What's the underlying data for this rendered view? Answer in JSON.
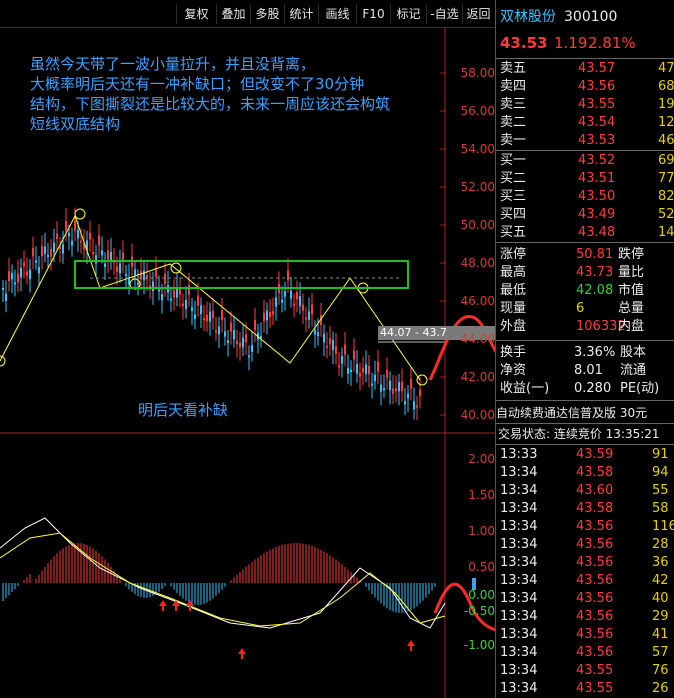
{
  "toolbar": {
    "buttons": [
      "复权",
      "叠加",
      "多股",
      "统计",
      "画线",
      "F10",
      "标记",
      "-自选",
      "返回"
    ]
  },
  "annotations": {
    "note_lines": [
      "虽然今天带了一波小量拉升，并且没背离，",
      "大概率明后天还有一冲补缺口；但改变不了30分钟",
      "结构，下图撕裂还是比较大的，未来一周应该还会构筑",
      "短线双底结构"
    ],
    "bottom_note": "明后天看补缺",
    "range_box": "44.07 - 43.7"
  },
  "price_axis": [
    "58.00",
    "56.00",
    "54.00",
    "52.00",
    "50.00",
    "48.00",
    "46.00",
    "44.00",
    "42.00",
    "40.00"
  ],
  "macd_axis": [
    "2.00",
    "1.50",
    "1.00",
    "0.50",
    "0.00",
    "-0.50",
    "-1.00"
  ],
  "stock": {
    "name": "双林股份",
    "code": "300100",
    "price": "43.53",
    "change": "1.19",
    "change_pct": "2.81%"
  },
  "order_book": {
    "asks": [
      {
        "label": "卖五",
        "price": "43.57",
        "vol": "47"
      },
      {
        "label": "卖四",
        "price": "43.56",
        "vol": "68"
      },
      {
        "label": "卖三",
        "price": "43.55",
        "vol": "190"
      },
      {
        "label": "卖二",
        "price": "43.54",
        "vol": "12"
      },
      {
        "label": "卖一",
        "price": "43.53",
        "vol": "46"
      }
    ],
    "bids": [
      {
        "label": "买一",
        "price": "43.52",
        "vol": "69"
      },
      {
        "label": "买二",
        "price": "43.51",
        "vol": "77"
      },
      {
        "label": "买三",
        "price": "43.50",
        "vol": "82"
      },
      {
        "label": "买四",
        "price": "43.49",
        "vol": "52"
      },
      {
        "label": "买五",
        "price": "43.48",
        "vol": "148"
      }
    ]
  },
  "stats": {
    "rows": [
      {
        "l1": "涨停",
        "v1": "50.81",
        "l2": "跌停"
      },
      {
        "l1": "最高",
        "v1": "43.73",
        "l2": "量比"
      },
      {
        "l1": "最低",
        "v1": "42.08",
        "l2": "市值"
      },
      {
        "l1": "现量",
        "v1": "6",
        "l2": "总量"
      },
      {
        "l1": "外盘",
        "v1": "106332",
        "l2": "内盘"
      }
    ]
  },
  "stats2": {
    "rows": [
      {
        "l1": "换手",
        "v1": "3.36%",
        "l2": "股本"
      },
      {
        "l1": "净资",
        "v1": "8.01",
        "l2": "流通"
      },
      {
        "l1": "收益(一)",
        "v1": "0.280",
        "l2": "PE(动)"
      }
    ]
  },
  "ad_text": "自动续费通达信普及版  30元",
  "trade_state": "交易状态: 连续竞价 13:35:21",
  "ticks": [
    {
      "t": "13:33",
      "p": "43.59",
      "v": "91"
    },
    {
      "t": "13:34",
      "p": "43.58",
      "v": "94"
    },
    {
      "t": "13:34",
      "p": "43.60",
      "v": "55"
    },
    {
      "t": "13:34",
      "p": "43.58",
      "v": "58"
    },
    {
      "t": "13:34",
      "p": "43.56",
      "v": "116"
    },
    {
      "t": "13:34",
      "p": "43.56",
      "v": "28"
    },
    {
      "t": "13:34",
      "p": "43.56",
      "v": "36"
    },
    {
      "t": "13:34",
      "p": "43.56",
      "v": "42"
    },
    {
      "t": "13:34",
      "p": "43.56",
      "v": "40"
    },
    {
      "t": "13:34",
      "p": "43.56",
      "v": "29"
    },
    {
      "t": "13:34",
      "p": "43.56",
      "v": "41"
    },
    {
      "t": "13:34",
      "p": "43.56",
      "v": "57"
    },
    {
      "t": "13:34",
      "p": "43.55",
      "v": "76"
    },
    {
      "t": "13:34",
      "p": "43.55",
      "v": "26"
    }
  ],
  "colors": {
    "up": "#ff3b3b",
    "down": "#36c4ff",
    "annotation": "#3da0ff",
    "box": "#1fbf1f"
  }
}
